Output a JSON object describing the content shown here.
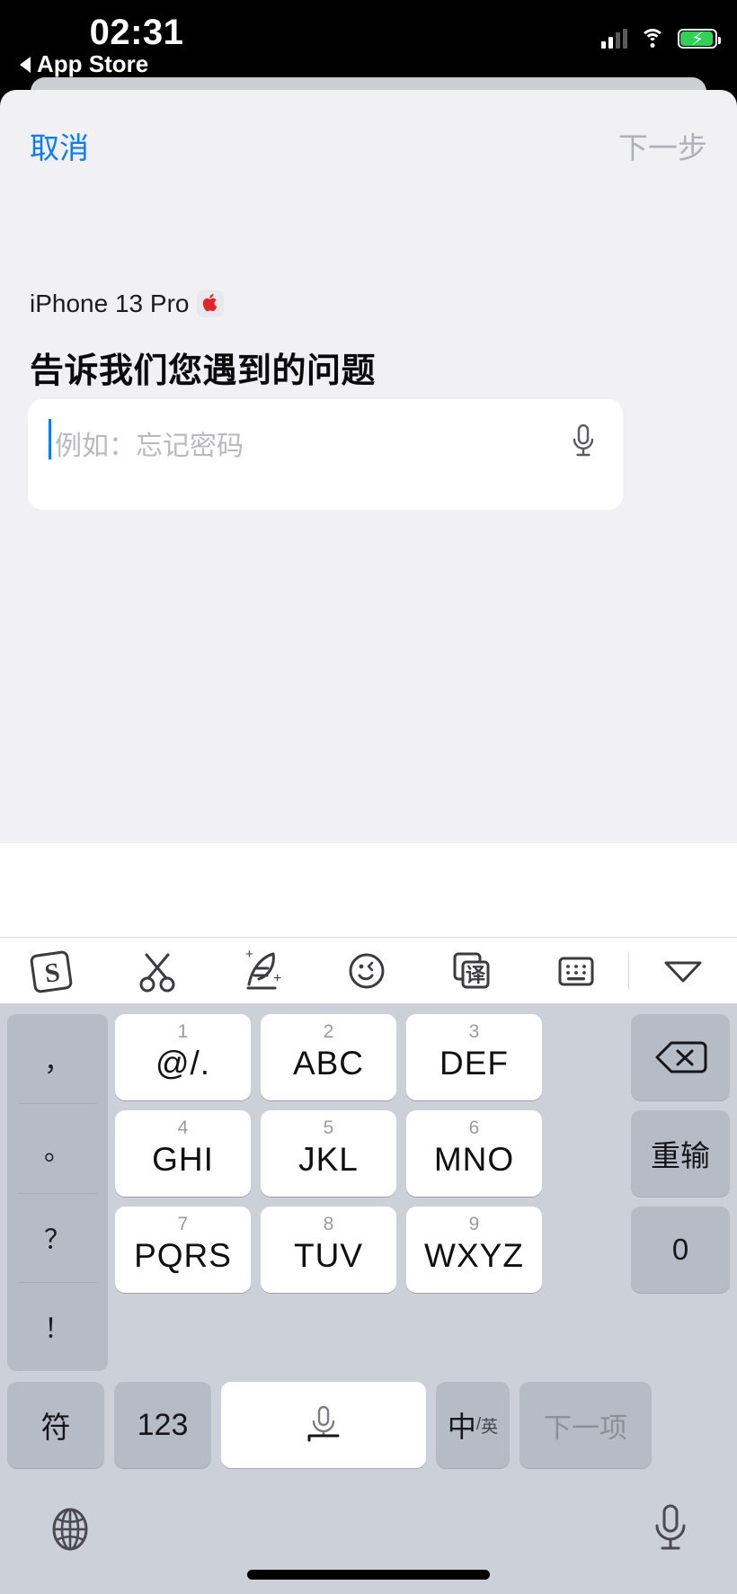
{
  "status_bar": {
    "time": "02:31",
    "back_label": "App Store",
    "back_icon": "triangle-left-icon",
    "signal_icon": "cellular-bars-icon",
    "wifi_icon": "wifi-icon",
    "battery_icon": "battery-charging-icon",
    "battery_color": "#31d158"
  },
  "sheet": {
    "nav": {
      "cancel_label": "取消",
      "cancel_color": "#0b7bf7",
      "next_label": "下一步",
      "next_color": "#b0b0b8"
    },
    "device": {
      "name": "iPhone 13 Pro",
      "badge_icon": "apple-logo-icon",
      "badge_glyph": "",
      "badge_color": "#e0262c"
    },
    "title": "告诉我们您遇到的问题",
    "input": {
      "value": "",
      "placeholder": "例如：忘记密码",
      "caret_color": "#0b7bf7",
      "mic_icon": "microphone-icon"
    }
  },
  "keyboard": {
    "toolbar": [
      {
        "icon": "sogou-logo-icon"
      },
      {
        "icon": "scissors-icon"
      },
      {
        "icon": "handwriting-feather-icon"
      },
      {
        "icon": "emoji-smiley-icon"
      },
      {
        "icon": "translate-icon",
        "glyph": "译"
      },
      {
        "icon": "keyboard-icon"
      },
      {
        "icon": "chevron-down-icon"
      }
    ],
    "punctuation_keys": [
      "，",
      "。",
      "？",
      "！"
    ],
    "keypad_rows": [
      [
        {
          "num": "1",
          "letters": "@/."
        },
        {
          "num": "2",
          "letters": "ABC"
        },
        {
          "num": "3",
          "letters": "DEF"
        }
      ],
      [
        {
          "num": "4",
          "letters": "GHI"
        },
        {
          "num": "5",
          "letters": "JKL"
        },
        {
          "num": "6",
          "letters": "MNO"
        }
      ],
      [
        {
          "num": "7",
          "letters": "PQRS"
        },
        {
          "num": "8",
          "letters": "TUV"
        },
        {
          "num": "9",
          "letters": "WXYZ"
        }
      ]
    ],
    "function_keys": {
      "delete_icon": "backspace-delete-icon",
      "redo_label": "重输",
      "zero_label": "0"
    },
    "bottom_row": {
      "symbols_label": "符",
      "numbers_label": "123",
      "space_icon": "microphone-icon",
      "lang_cn": "中",
      "lang_sep": "/",
      "lang_en": "英",
      "next_item_label": "下一项"
    },
    "system_row": {
      "globe_icon": "globe-icon",
      "mic_icon": "microphone-icon"
    }
  }
}
